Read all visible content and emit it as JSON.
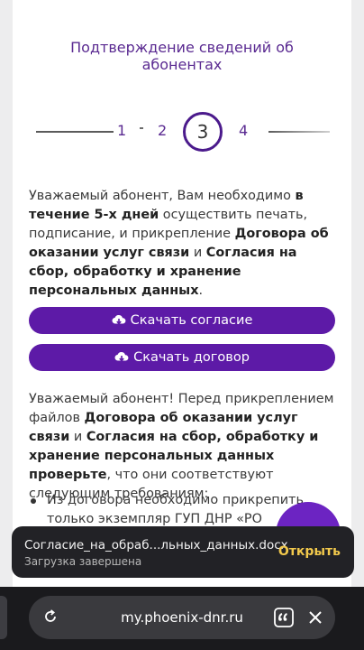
{
  "page": {
    "title": "Подтверждение сведений об абонентах",
    "steps": [
      "1",
      "2",
      "3",
      "4"
    ],
    "active_step": "3"
  },
  "intro": {
    "t1": "Уважаемый абонент, Вам необходимо ",
    "b1": "в течение 5-х дней",
    "t2": " осуществить печать, подписание, и прикрепление ",
    "b2": "Договора об оказании услуг связи",
    "t3": " и ",
    "b3": "Согласия на сбор, обработку и хранение персональных данных",
    "t4": "."
  },
  "buttons": {
    "consent": "Скачать согласие",
    "contract": "Скачать договор"
  },
  "requirements": {
    "t1": "Уважаемый абонент! Перед прикреплением файлов ",
    "b1": "Договора об оказании услуг связи",
    "t2": " и ",
    "b2": "Согласия на сбор, обработку и хранение персональных данных проверьте",
    "t3": ", что они соответствуют следующим требованиям:",
    "bullet1": "Из договора необходимо прикрепить только экземпляр ГУП ДНР «РО"
  },
  "download_toast": {
    "filename": "Согласие_на_обраб...льных_данных.docx",
    "status": "Загрузка завершена",
    "action": "Открыть"
  },
  "browser": {
    "url": "my.phoenix-dnr.ru"
  },
  "colors": {
    "accent": "#5d1aa7",
    "title": "#5a2a91",
    "toast_action": "#f2c94c"
  }
}
